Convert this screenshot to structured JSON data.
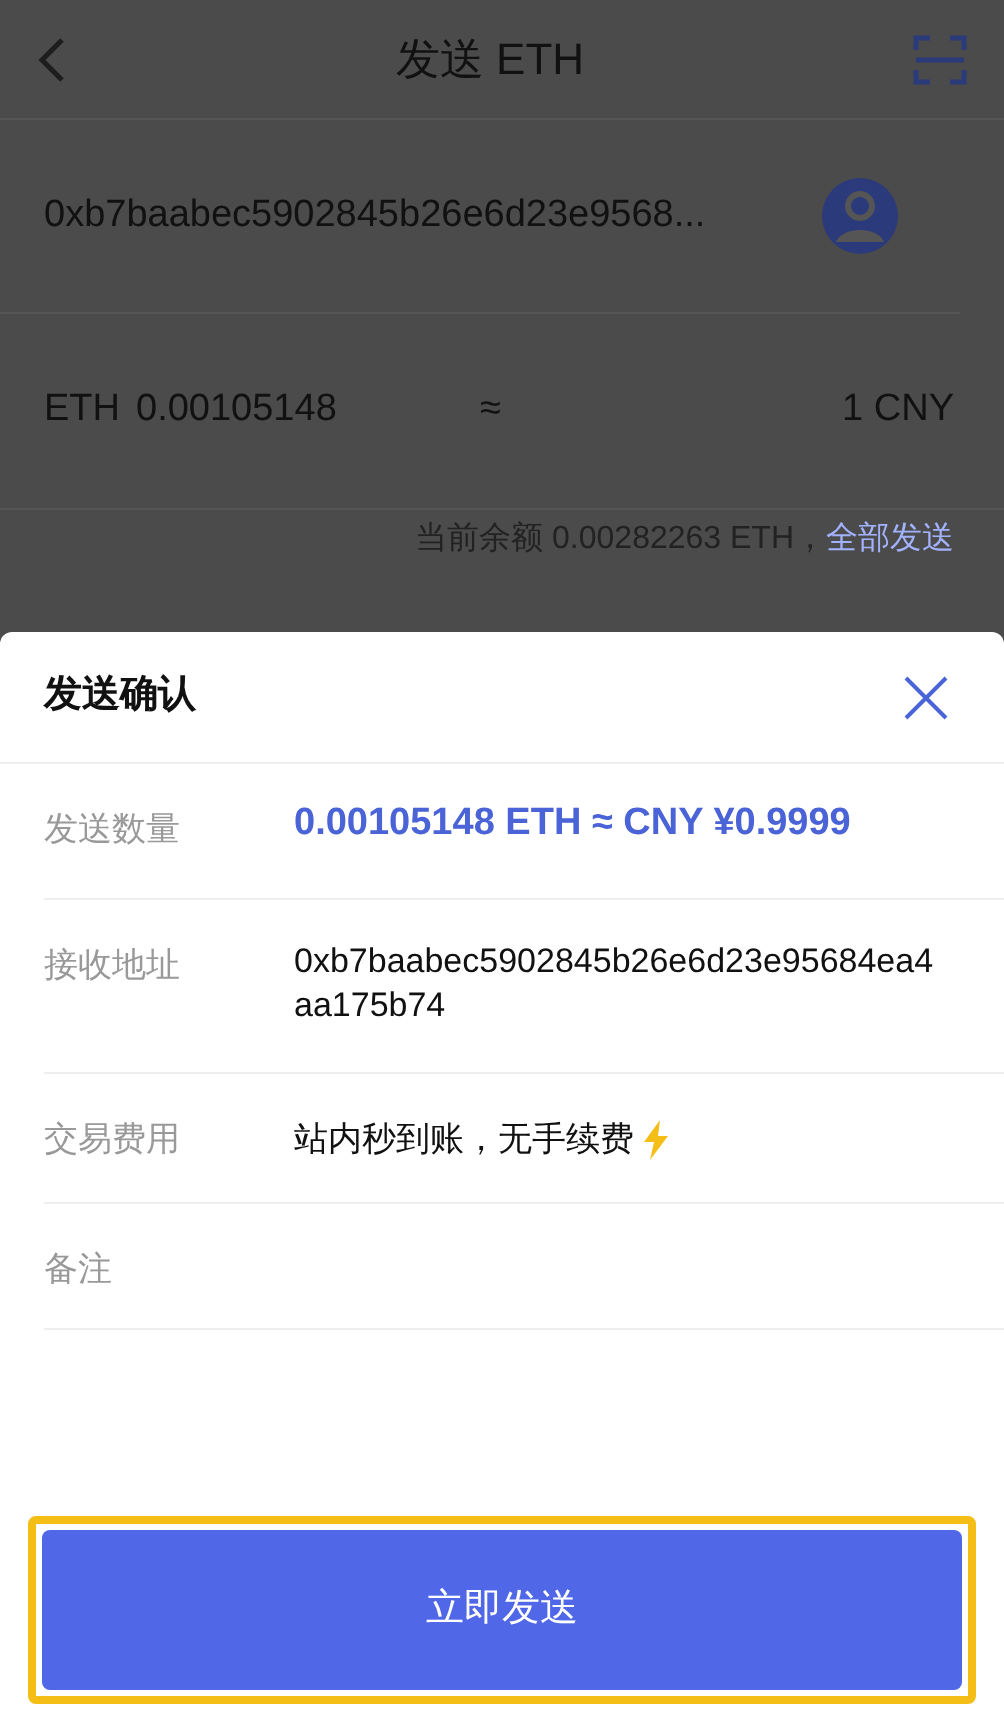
{
  "header": {
    "title": "发送 ETH"
  },
  "recipient": {
    "address": "0xb7baabec5902845b26e6d23e9568..."
  },
  "amount": {
    "currency": "ETH",
    "value": "0.00105148",
    "approx": "≈",
    "fiat": "1 CNY"
  },
  "balance": {
    "text": "当前余额 0.00282263 ETH，",
    "send_all": "全部发送"
  },
  "sheet": {
    "title": "发送确认",
    "rows": [
      {
        "label": "发送数量",
        "value": "0.00105148 ETH ≈ CNY ¥0.9999",
        "kind": "highlight"
      },
      {
        "label": "接收地址",
        "value": "0xb7baabec5902845b26e6d23e95684ea4aa175b74",
        "kind": "address"
      },
      {
        "label": "交易费用",
        "value": "站内秒到账，无手续费",
        "kind": "fee"
      },
      {
        "label": "备注",
        "kind": "empty"
      }
    ],
    "confirm_button": "立即发送"
  }
}
